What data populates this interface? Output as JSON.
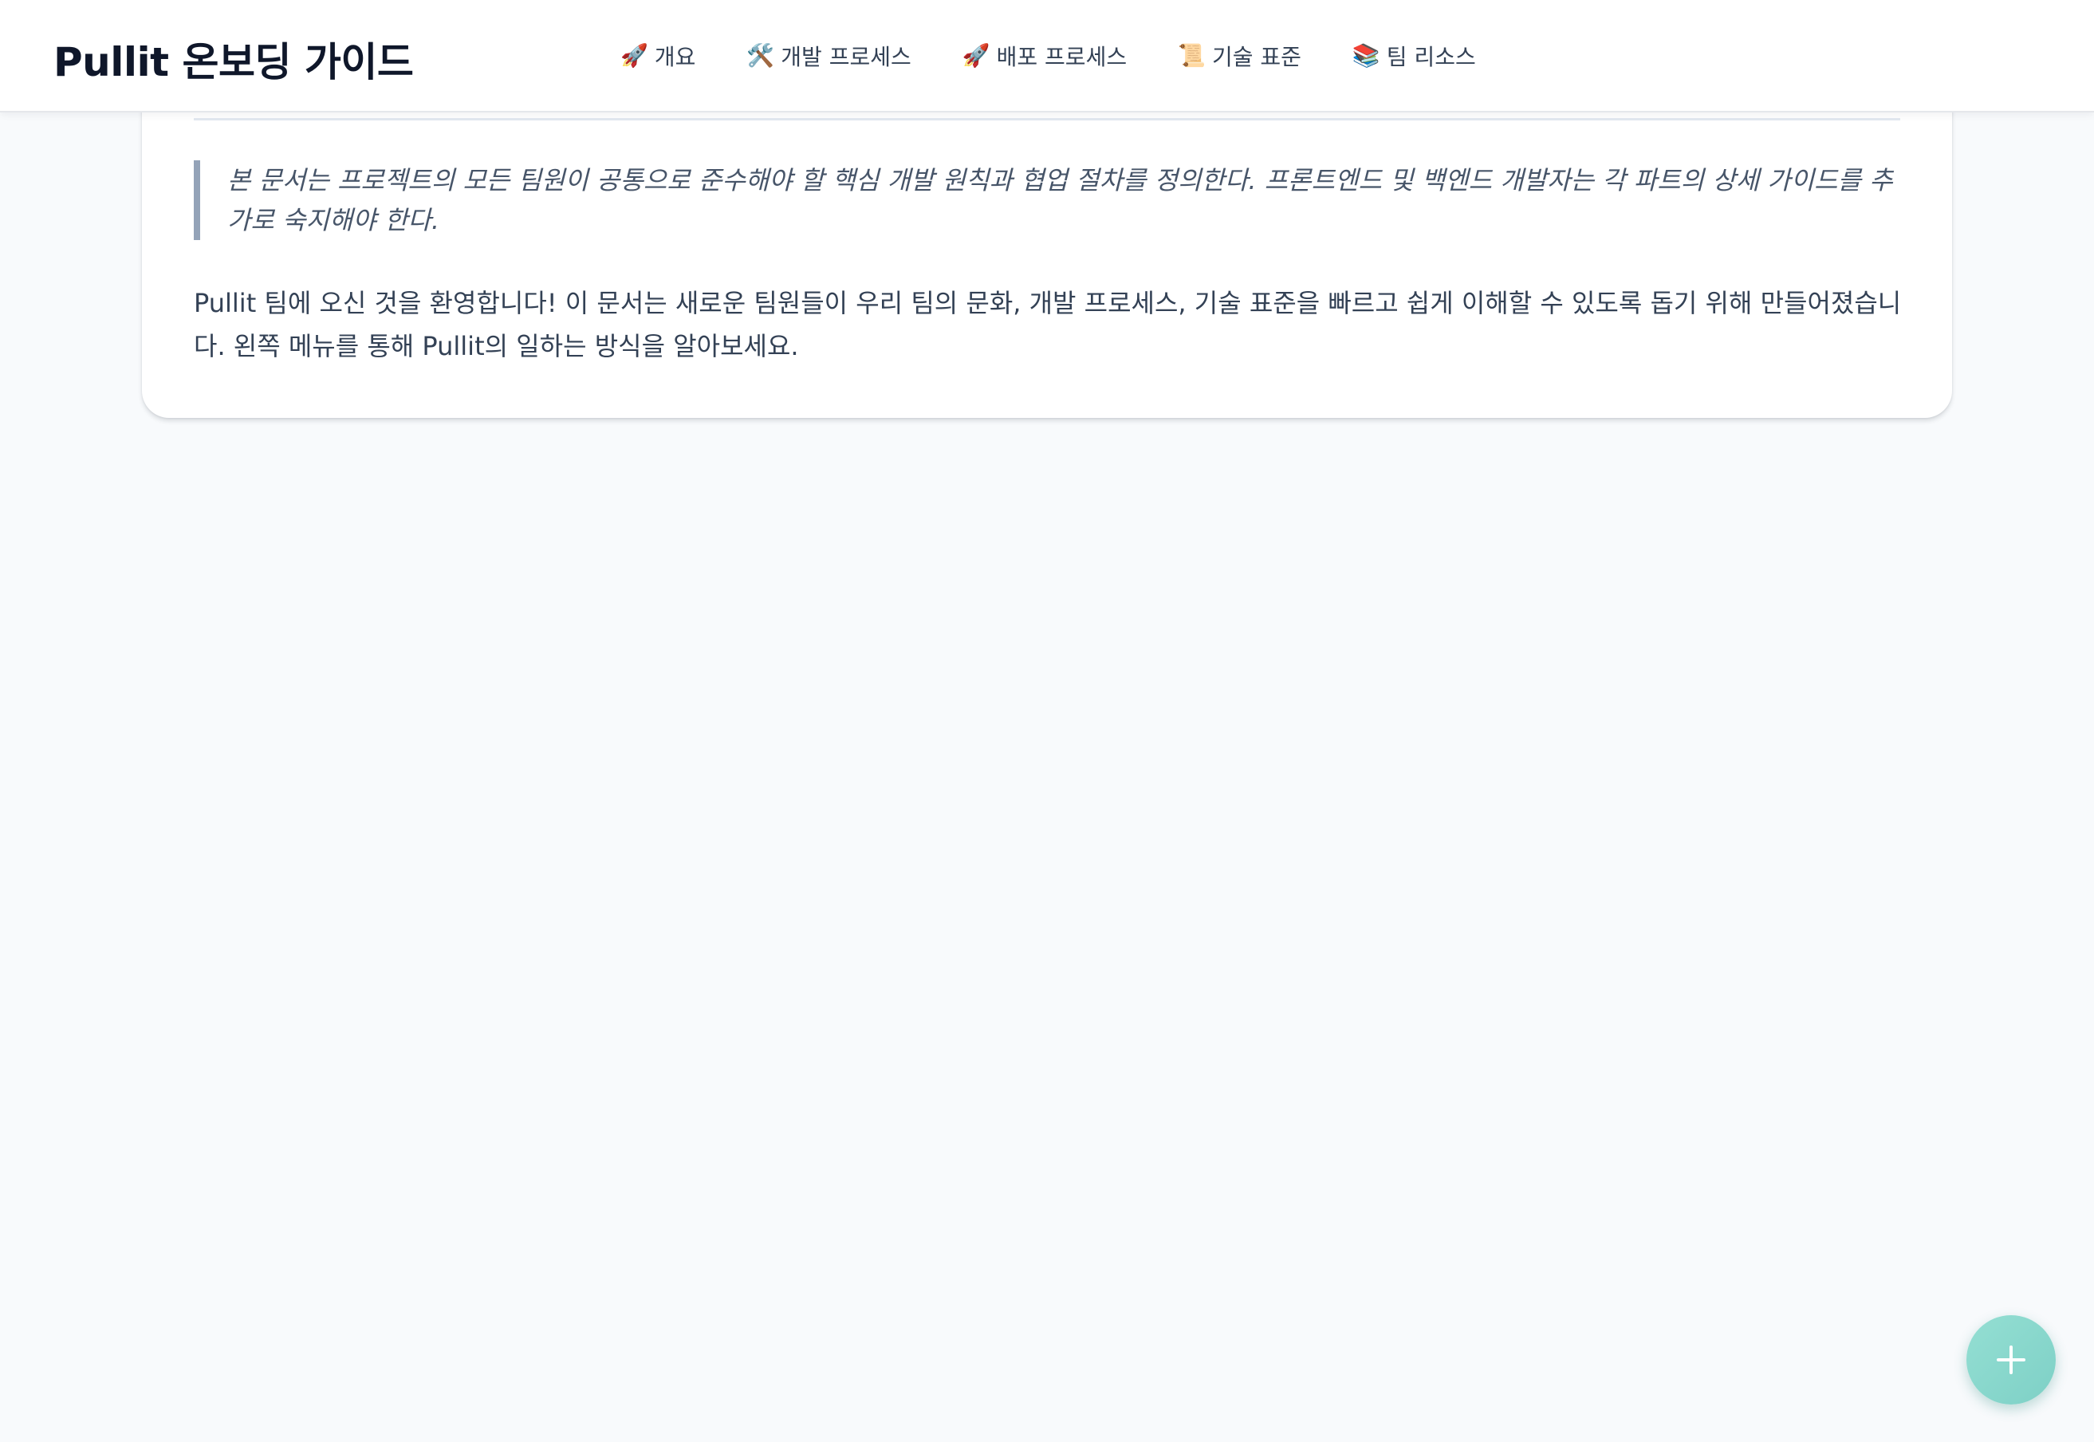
{
  "header": {
    "title": "Pullit 온보딩 가이드",
    "nav": [
      {
        "icon": "🚀",
        "icon_name": "rocket-icon",
        "label": "개요"
      },
      {
        "icon": "🛠️",
        "icon_name": "tools-icon",
        "label": "개발 프로세스"
      },
      {
        "icon": "🚀",
        "icon_name": "rocket-icon",
        "label": "배포 프로세스"
      },
      {
        "icon": "📜",
        "icon_name": "scroll-icon",
        "label": "기술 표준"
      },
      {
        "icon": "📚",
        "icon_name": "books-icon",
        "label": "팀 리소스"
      }
    ]
  },
  "content": {
    "quote": "본 문서는 프로젝트의 모든 팀원이 공통으로 준수해야 할 핵심 개발 원칙과 협업 절차를 정의한다. 프론트엔드 및 백엔드 개발자는 각 파트의 상세 가이드를 추가로 숙지해야 한다.",
    "intro": "Pullit 팀에 오신 것을 환영합니다! 이 문서는 새로운 팀원들이 우리 팀의 문화, 개발 프로세스, 기술 표준을 빠르고 쉽게 이해할 수 있도록 돕기 위해 만들어졌습니다. 왼쪽 메뉴를 통해 Pullit의 일하는 방식을 알아보세요."
  },
  "fab": {
    "icon_name": "plus-icon"
  },
  "colors": {
    "background": "#f8fafc",
    "fab": "#86d6cb",
    "quote_border": "#94a3b8"
  }
}
